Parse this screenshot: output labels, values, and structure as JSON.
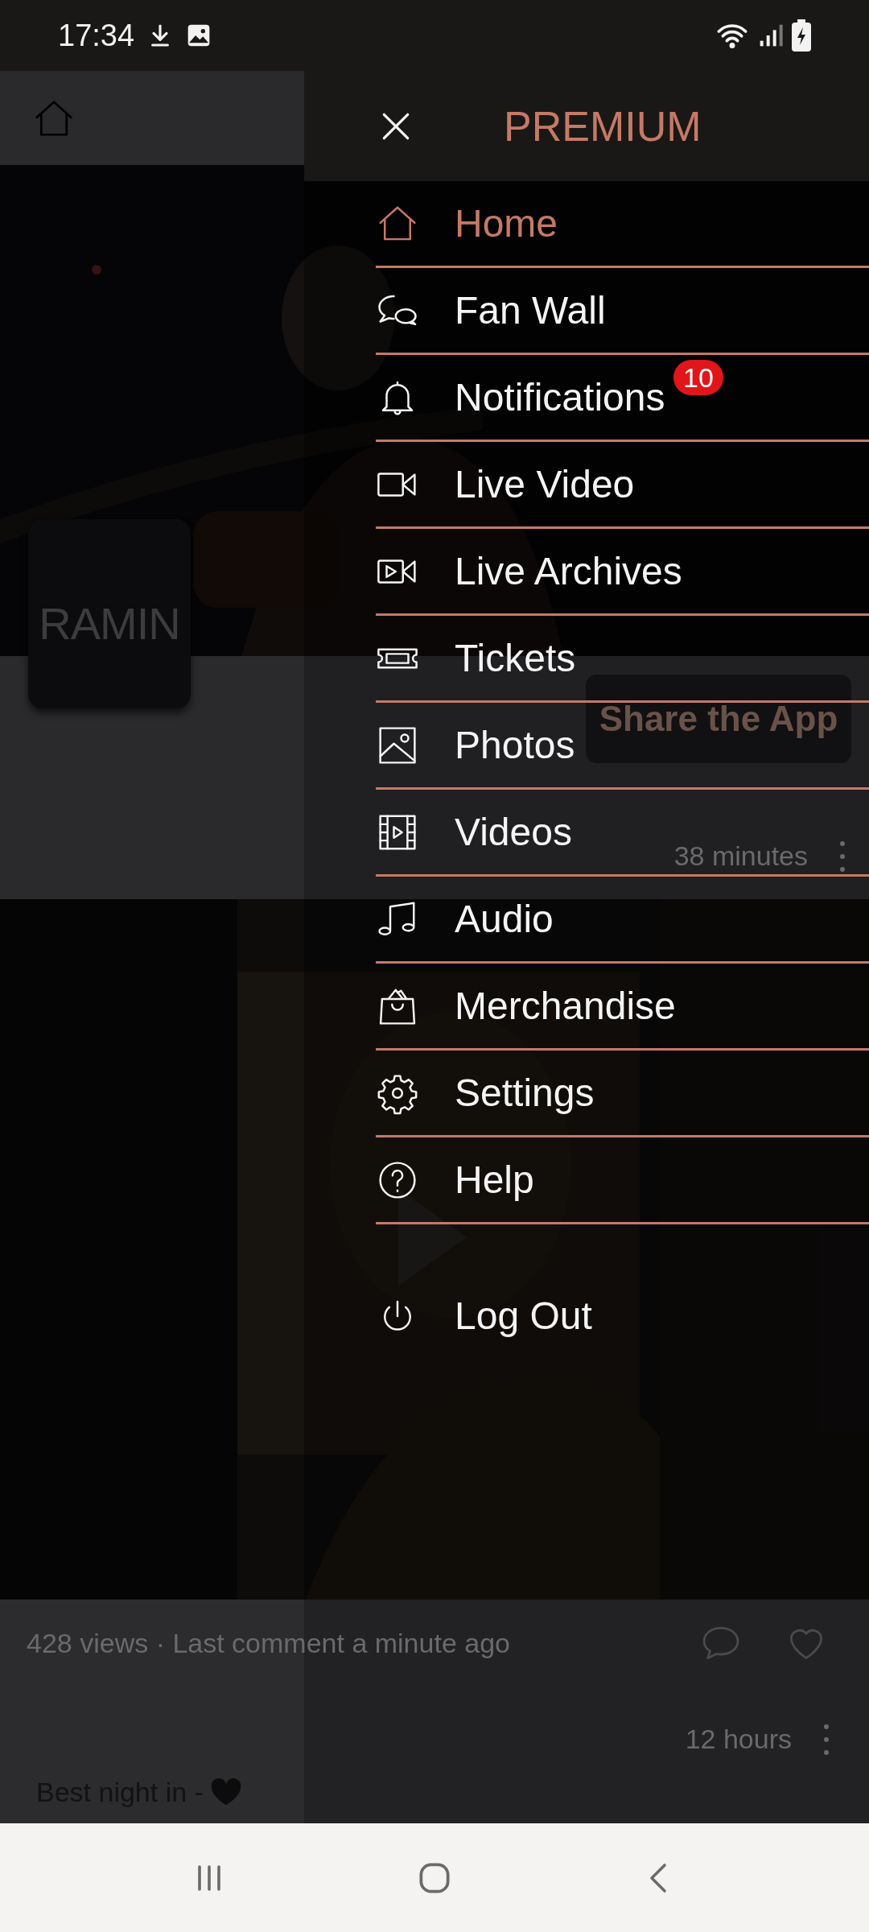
{
  "status_bar": {
    "time": "17:34"
  },
  "app_page": {
    "logo": "RAMIN",
    "share_button": "Share the App",
    "post_time": "38 minutes",
    "stats": "428 views · Last comment a minute ago",
    "next_post_time": "12 hours",
    "next_post_caption": "Best night in -"
  },
  "drawer": {
    "title": "PREMIUM",
    "items": [
      {
        "label": "Home",
        "selected": true
      },
      {
        "label": "Fan Wall",
        "selected": false
      },
      {
        "label": "Notifications",
        "selected": false,
        "badge": "10"
      },
      {
        "label": "Live Video",
        "selected": false
      },
      {
        "label": "Live Archives",
        "selected": false
      },
      {
        "label": "Tickets",
        "selected": false
      },
      {
        "label": "Photos",
        "selected": false
      },
      {
        "label": "Videos",
        "selected": false
      },
      {
        "label": "Audio",
        "selected": false
      },
      {
        "label": "Merchandise",
        "selected": false
      },
      {
        "label": "Settings",
        "selected": false
      },
      {
        "label": "Help",
        "selected": false
      }
    ],
    "logout": {
      "label": "Log Out"
    }
  }
}
